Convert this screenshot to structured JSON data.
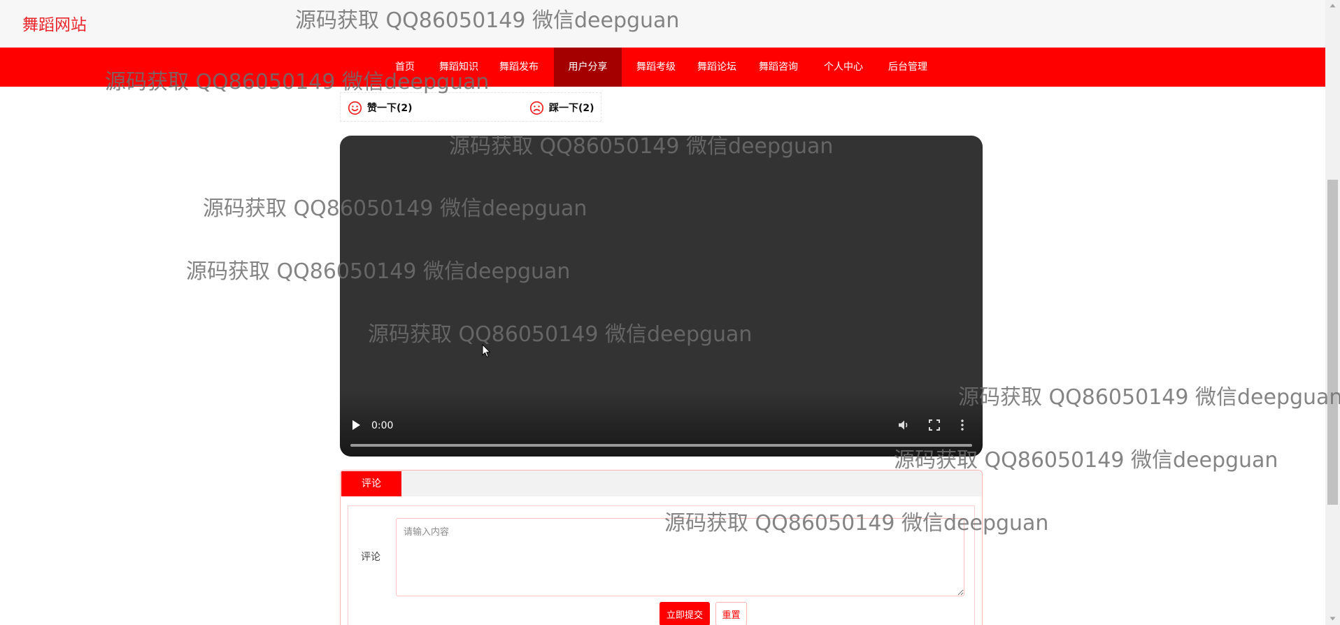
{
  "site": {
    "title": "舞蹈网站"
  },
  "nav": {
    "items": [
      {
        "label": "首页"
      },
      {
        "label": "舞蹈知识"
      },
      {
        "label": "舞蹈发布"
      },
      {
        "label": "用户分享",
        "active": true
      },
      {
        "label": "舞蹈考级"
      },
      {
        "label": "舞蹈论坛"
      },
      {
        "label": "舞蹈咨询"
      },
      {
        "label": "个人中心"
      },
      {
        "label": "后台管理"
      }
    ]
  },
  "vote": {
    "like": {
      "label": "赞一下(2)",
      "icon": "smile-icon"
    },
    "dislike": {
      "label": "踩一下(2)",
      "icon": "frown-icon"
    }
  },
  "video": {
    "time": "0:00",
    "progress": 0,
    "icons": [
      "play-icon",
      "volume-icon",
      "fullscreen-icon",
      "more-vert-icon"
    ]
  },
  "comment": {
    "tab_label": "评论",
    "field_label": "评论",
    "placeholder": "请输入内容",
    "value": "",
    "submit_label": "立即提交",
    "reset_label": "重置"
  },
  "watermark": {
    "text": "源码获取 QQ86050149 微信deepguan"
  },
  "colors": {
    "brand_red": "#ff0000",
    "nav_active": "#a40000",
    "title_red": "#e8262b",
    "video_bg": "#333333"
  }
}
